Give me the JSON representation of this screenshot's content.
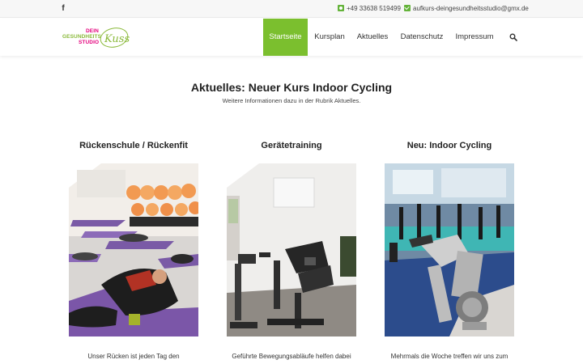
{
  "topbar": {
    "facebook_icon": "facebook-icon",
    "phone": "+49 33638 519499",
    "email": "aufkurs-deingesundheitsstudio@gmx.de",
    "accent_color": "#64b33a"
  },
  "logo": {
    "line1": "DEIN",
    "line2": "GESUNDHEITS",
    "line3": "STUDIO",
    "script": "Kuss"
  },
  "nav": {
    "items": [
      {
        "label": "Startseite",
        "active": true
      },
      {
        "label": "Kursplan",
        "active": false
      },
      {
        "label": "Aktuelles",
        "active": false
      },
      {
        "label": "Datenschutz",
        "active": false
      },
      {
        "label": "Impressum",
        "active": false
      }
    ],
    "search_icon": "search-icon",
    "active_color": "#7bbf2e"
  },
  "hero": {
    "title": "Aktuelles: Neuer Kurs Indoor Cycling",
    "subtitle": "Weitere Informationen dazu in der Rubrik Aktuelles."
  },
  "columns": [
    {
      "title": "Rückenschule / Rückenfit",
      "text": "Unser Rücken ist jeden Tag den"
    },
    {
      "title": "Gerätetraining",
      "text": "Geführte Bewegungsabläufe helfen dabei"
    },
    {
      "title": "Neu: Indoor Cycling",
      "text": "Mehrmals die Woche treffen wir uns zum"
    }
  ]
}
